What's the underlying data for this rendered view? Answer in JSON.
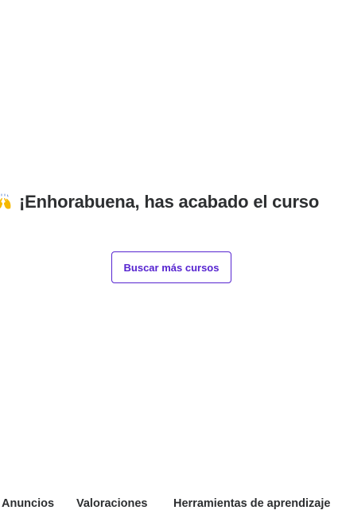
{
  "congrats": {
    "emoji": "raising-hands-icon",
    "message": "¡Enhorabuena, has acabado el curso"
  },
  "cta": {
    "label": "Buscar más cursos"
  },
  "tabs": [
    {
      "label": "Anuncios"
    },
    {
      "label": "Valoraciones"
    },
    {
      "label": "Herramientas de aprendizaje"
    }
  ],
  "colors": {
    "accent": "#5624d0",
    "text": "#2d2f31",
    "emoji": "#f5b800"
  }
}
